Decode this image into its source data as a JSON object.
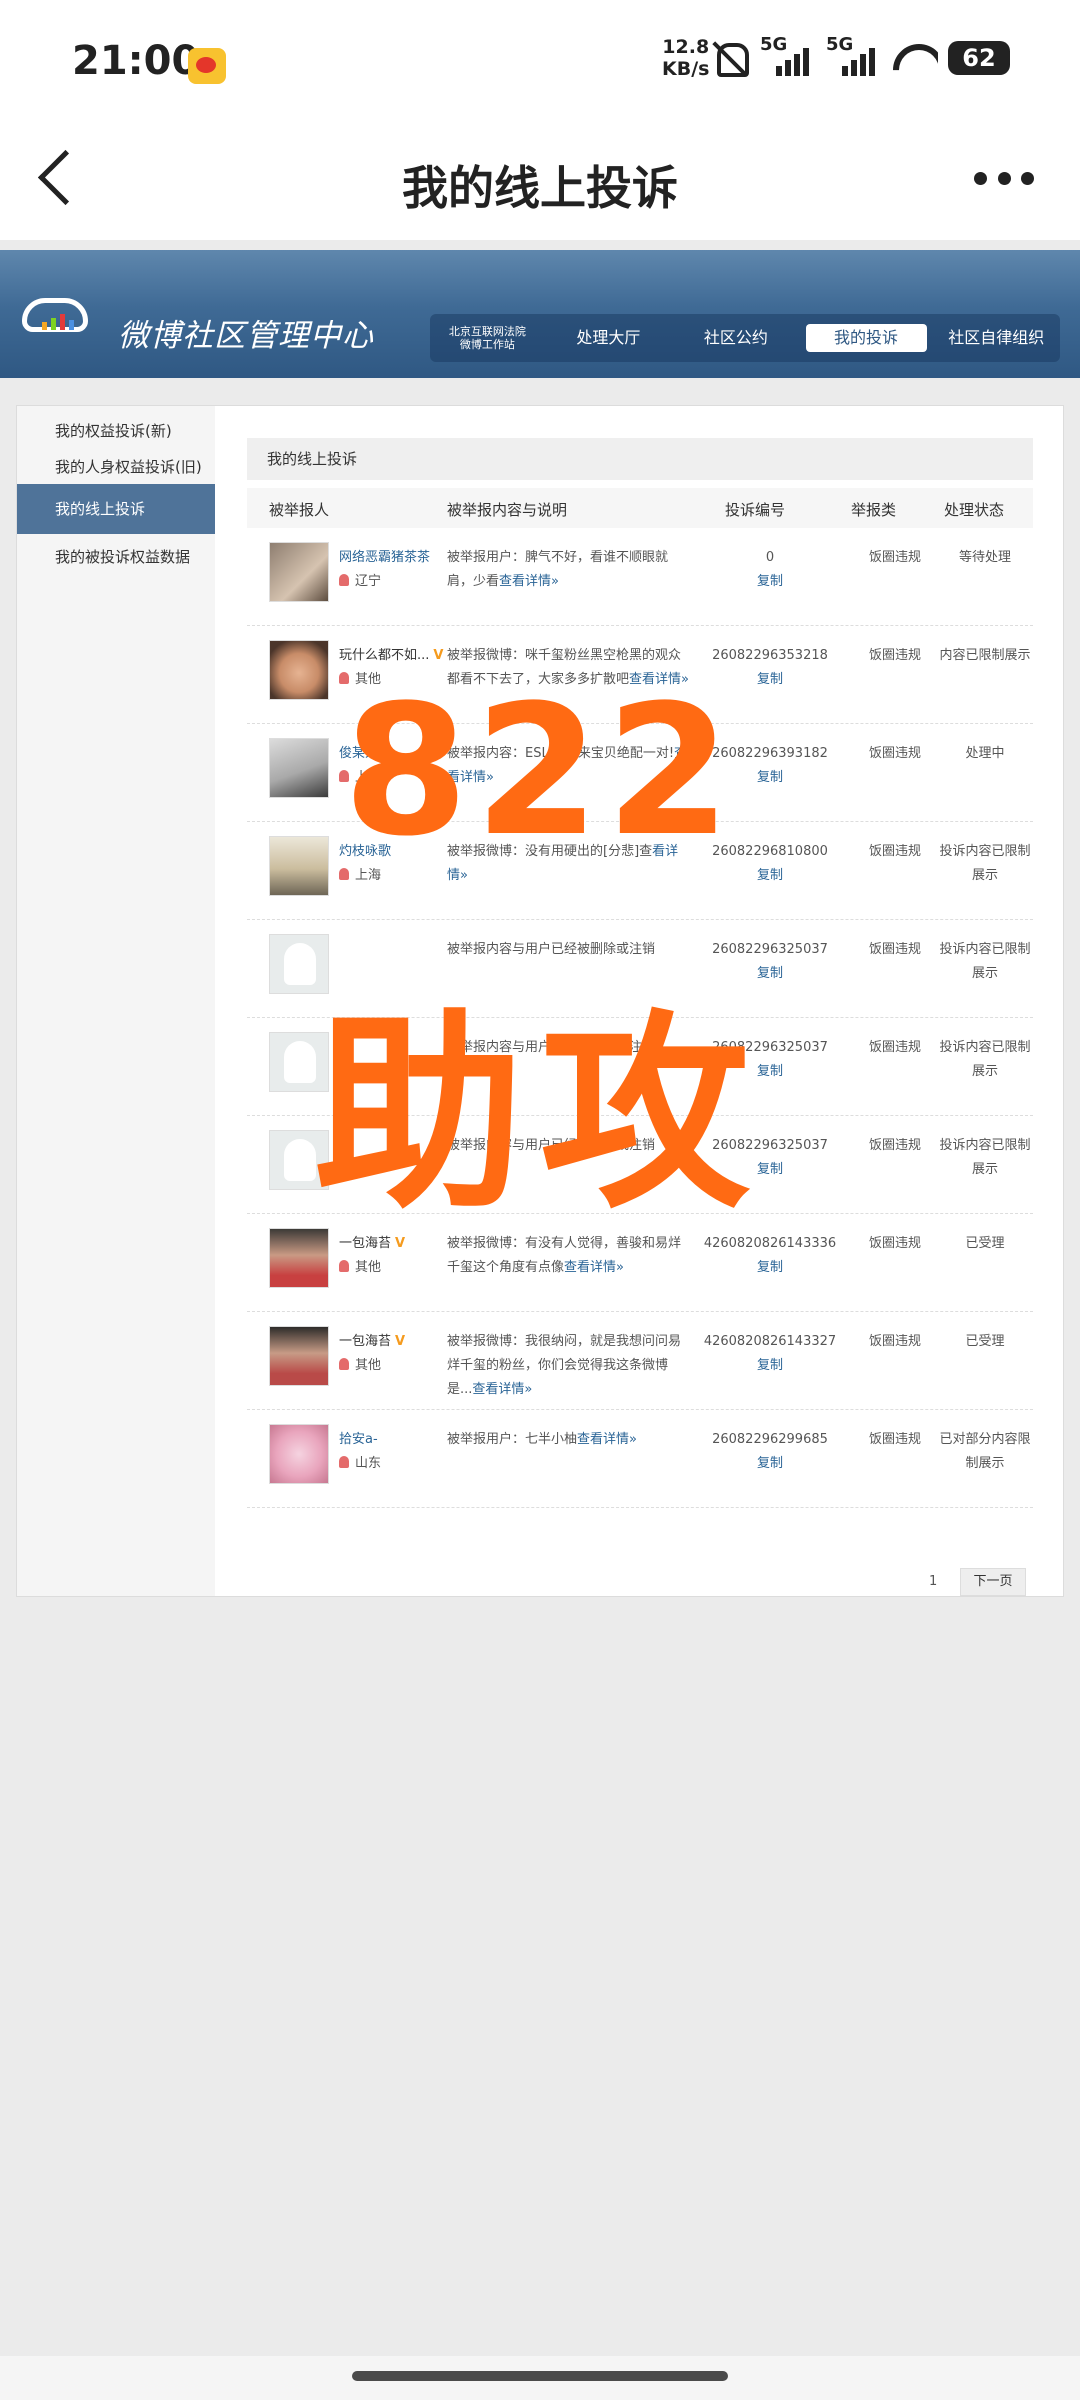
{
  "status_bar": {
    "time": "21:00",
    "netspeed_value": "12.8",
    "netspeed_unit": "KB/s",
    "signal1": "5G",
    "signal2": "5G",
    "battery": "62"
  },
  "nav": {
    "title": "我的线上投诉"
  },
  "banner": {
    "title": "微博社区管理中心",
    "nav_items": [
      {
        "label": "北京互联网法院\n微博工作站"
      },
      {
        "label": "处理大厅"
      },
      {
        "label": "社区公约"
      },
      {
        "label": "我的投诉"
      },
      {
        "label": "社区自律组织"
      }
    ]
  },
  "sidebar": {
    "items": [
      {
        "label": "我的权益投诉(新)"
      },
      {
        "label": "我的人身权益投诉(旧)"
      },
      {
        "label": "我的线上投诉"
      },
      {
        "label": "我的被投诉权益数据"
      }
    ]
  },
  "main": {
    "title": "我的线上投诉",
    "columns": [
      "被举报人",
      "被举报内容与说明",
      "投诉编号",
      "举报类",
      "处理状态"
    ],
    "rows": [
      {
        "user": "网络恶霸猪茶茶",
        "location": "辽宁",
        "content": "被举报用户：脾气不好，看谁不顺眼就肩，少看",
        "link": "查看详情»",
        "id": "0",
        "copy": "复制",
        "type": "饭圈违规",
        "status": "等待处理"
      },
      {
        "user": "玩什么都不如...",
        "location": "其他",
        "content": "被举报微博：咪千玺粉丝黑空枪黑的观众都看不下去了，大家多多扩散吧",
        "link": "查看详情»",
        "id": "26082296353218",
        "copy": "复制",
        "type": "饭圈违规",
        "status": "内容已限制展示"
      },
      {
        "user": "俊某人吸",
        "location": "上海",
        "content": "被举报内容：ESLIE 我来宝贝绝配一对!",
        "link": "查看详情»",
        "id": "26082296393182",
        "copy": "复制",
        "type": "饭圈违规",
        "status": "处理中"
      },
      {
        "user": "灼枝咏歌",
        "location": "上海",
        "content": "被举报微博：没有用硬出的[分悲]查",
        "link": "看详情»",
        "id": "26082296810800",
        "copy": "复制",
        "type": "饭圈违规",
        "status": "投诉内容已限制展示"
      },
      {
        "user": "",
        "location": "",
        "content": "被举报内容与用户已经被删除或注销",
        "link": "",
        "id": "26082296325037",
        "copy": "复制",
        "type": "饭圈违规",
        "status": "投诉内容已限制展示"
      },
      {
        "user": "",
        "location": "",
        "content": "被举报内容与用户已经被删除或注销",
        "link": "",
        "id": "26082296325037",
        "copy": "复制",
        "type": "饭圈违规",
        "status": "投诉内容已限制展示"
      },
      {
        "user": "",
        "location": "",
        "content": "被举报内容与用户已经被删除或注销",
        "link": "",
        "id": "26082296325037",
        "copy": "复制",
        "type": "饭圈违规",
        "status": "投诉内容已限制展示"
      },
      {
        "user": "一包海苔",
        "location": "其他",
        "content": "被举报微博：有没有人觉得，善骏和易烊千玺这个角度有点像",
        "link": "查看详情»",
        "id": "4260820826143336",
        "copy": "复制",
        "type": "饭圈违规",
        "status": "已受理"
      },
      {
        "user": "一包海苔",
        "location": "其他",
        "content": "被举报微博：我很纳闷，就是我想问问易烊千玺的粉丝，你们会觉得我这条微博是...",
        "link": "查看详情»",
        "id": "4260820826143327",
        "copy": "复制",
        "type": "饭圈违规",
        "status": "已受理"
      },
      {
        "user": "拾安a-",
        "location": "山东",
        "content": "被举报用户：七半小柚",
        "link": "查看详情»",
        "id": "26082296299685",
        "copy": "复制",
        "type": "饭圈违规",
        "status": "已对部分内容限制展示"
      }
    ],
    "pager": {
      "page": "1",
      "next": "下一页"
    }
  },
  "overlay": {
    "number": "822",
    "text": "助攻"
  }
}
